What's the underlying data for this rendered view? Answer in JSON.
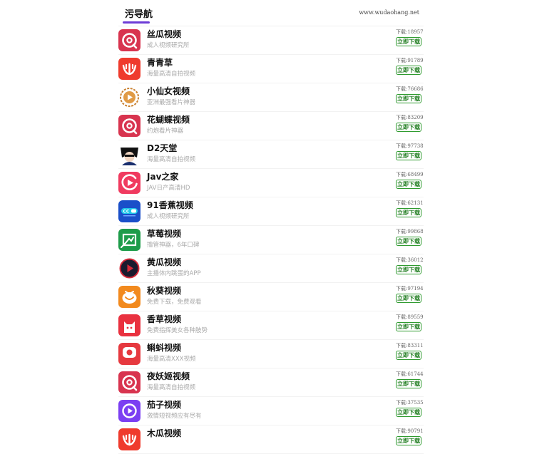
{
  "header": {
    "brand": "污导航",
    "domain": "www.wudaohang.net"
  },
  "colors": {
    "accent": "#6c3bd6",
    "download_border": "#2f9b2f"
  },
  "download_label": "立即下载",
  "items": [
    {
      "title": "丝瓜视频",
      "desc": "成人视频研究所",
      "count": "下载:18957",
      "icon": "loop-icon"
    },
    {
      "title": "青青草",
      "desc": "海量高清自拍视频",
      "count": "下载:91789",
      "icon": "grass-icon"
    },
    {
      "title": "小仙女视频",
      "desc": "亚洲最强看片神器",
      "count": "下载:76686",
      "icon": "play-ring-icon"
    },
    {
      "title": "花蝴蝶视频",
      "desc": "约炮看片神器",
      "count": "下载:83209",
      "icon": "loop-icon"
    },
    {
      "title": "D2天堂",
      "desc": "海量高清自拍视频",
      "count": "下载:97738",
      "icon": "avatar-icon"
    },
    {
      "title": "Jav之家",
      "desc": "JAV日产高清HD",
      "count": "下载:68499",
      "icon": "play-circle-icon"
    },
    {
      "title": "91香蕉视频",
      "desc": "成人视频研究所",
      "count": "下载:62131",
      "icon": "cc-icon"
    },
    {
      "title": "草莓视频",
      "desc": "撸管神器，6年口碑",
      "count": "下载:99868",
      "icon": "frame-icon"
    },
    {
      "title": "黄瓜视频",
      "desc": "主播体内跳蛋的APP",
      "count": "下载:36012",
      "icon": "dark-play-icon"
    },
    {
      "title": "秋葵视频",
      "desc": "免费下载，免费观看",
      "count": "下载:97194",
      "icon": "tv-icon"
    },
    {
      "title": "香草视频",
      "desc": "免费指挥美女各种肢势",
      "count": "下载:89559",
      "icon": "cat-icon"
    },
    {
      "title": "蝌蚪视频",
      "desc": "海量高清XXX视频",
      "count": "下载:83311",
      "icon": "kedou-icon"
    },
    {
      "title": "夜妖姬视频",
      "desc": "海量高清自拍视频",
      "count": "下载:61744",
      "icon": "loop-icon"
    },
    {
      "title": "茄子视频",
      "desc": "激情短视频应有尽有",
      "count": "下载:37535",
      "icon": "purple-play-icon"
    },
    {
      "title": "木瓜视频",
      "desc": "",
      "count": "下载:90791",
      "icon": "grass-icon"
    }
  ]
}
